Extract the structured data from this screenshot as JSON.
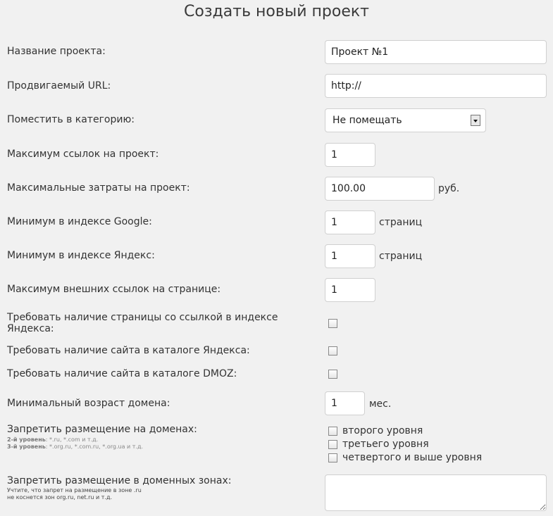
{
  "page": {
    "title": "Создать новый проект"
  },
  "form": {
    "project_name": {
      "label": "Название проекта:",
      "value": "Проект №1"
    },
    "url": {
      "label": "Продвигаемый URL:",
      "value": "http://"
    },
    "category": {
      "label": "Поместить в категорию:",
      "selected": "Не помещать"
    },
    "max_links": {
      "label": "Максимум ссылок на проект:",
      "value": "1"
    },
    "max_cost": {
      "label": "Максимальные затраты на проект:",
      "value": "100.00",
      "unit": "руб."
    },
    "min_google": {
      "label": "Минимум в индексе Google:",
      "value": "1",
      "unit": "страниц"
    },
    "min_yandex": {
      "label": "Минимум в индексе Яндекс:",
      "value": "1",
      "unit": "страниц"
    },
    "max_ext_links": {
      "label": "Максимум внешних ссылок на странице:",
      "value": "1"
    },
    "require_yandex_index": {
      "label_line1": "Требовать наличие страницы со ссылкой в индексе",
      "label_line2": "Яндекса:",
      "checked": false
    },
    "require_yandex_catalog": {
      "label": "Требовать наличие сайта в каталоге Яндекса:",
      "checked": false
    },
    "require_dmoz": {
      "label": "Требовать наличие сайта в каталоге DMOZ:",
      "checked": false
    },
    "min_domain_age": {
      "label": "Минимальный возраст домена:",
      "value": "1",
      "unit": "мес."
    },
    "forbid_domains": {
      "label": "Запретить размещение на доменах:",
      "hint1_bold": "2-й уровень",
      "hint1_text": ": *.ru, *.com и т.д.",
      "hint2_bold": "3-й уровень",
      "hint2_text": ": *.org.ru, *.com.ru, *.org.ua и т.д.",
      "options": [
        {
          "label": "второго уровня",
          "checked": false
        },
        {
          "label": "третьего уровня",
          "checked": false
        },
        {
          "label": "четвертого и выше уровня",
          "checked": false
        }
      ]
    },
    "forbid_zones": {
      "label": "Запретить размещение в доменных зонах:",
      "hint_line1": "Учтите, что запрет на размещение в зоне .ru",
      "hint_line2": "не коснется зон org.ru, net.ru и т.д.",
      "value": ""
    }
  }
}
